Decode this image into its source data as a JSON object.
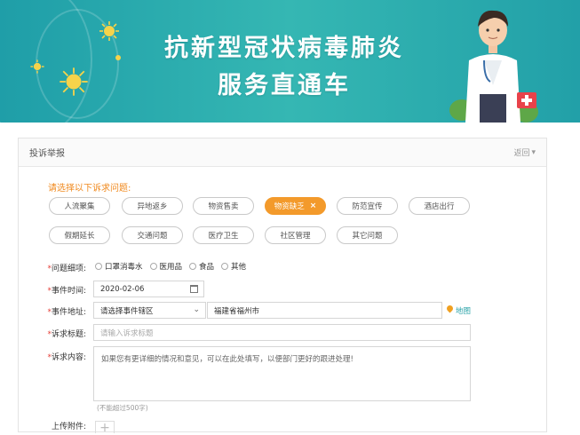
{
  "banner": {
    "title_line1": "抗新型冠状病毒肺炎",
    "title_line2": "服务直通车"
  },
  "panel": {
    "title": "投诉举报",
    "back_label": "返回",
    "back_icon": "chevron-down-icon"
  },
  "prompt": "请选择以下诉求问题:",
  "tags": [
    {
      "label": "人流聚集",
      "active": false
    },
    {
      "label": "异地返乡",
      "active": false
    },
    {
      "label": "物资售卖",
      "active": false
    },
    {
      "label": "物资缺乏",
      "active": true
    },
    {
      "label": "防范宣传",
      "active": false
    },
    {
      "label": "酒店出行",
      "active": false
    },
    {
      "label": "假期延长",
      "active": false
    },
    {
      "label": "交通问题",
      "active": false
    },
    {
      "label": "医疗卫生",
      "active": false
    },
    {
      "label": "社区管理",
      "active": false
    },
    {
      "label": "其它问题",
      "active": false
    }
  ],
  "form": {
    "detail_label": "问题细项:",
    "detail_options": [
      "口罩消毒水",
      "医用品",
      "食品",
      "其他"
    ],
    "time_label": "事件时间:",
    "time_value": "2020-02-06",
    "location_label": "事件地址:",
    "district_placeholder": "请选择事件辖区",
    "address_value": "福建省福州市",
    "map_label": "地图",
    "subject_label": "诉求标题:",
    "subject_placeholder": "请输入诉求标题",
    "content_label": "诉求内容:",
    "content_placeholder": "如果您有更详细的情况和意见，可以在此处填写，以便部门更好的跟进处理!",
    "content_limit": "(不能超过500字)",
    "upload_label": "上传附件:",
    "required_mark": "*"
  },
  "colors": {
    "banner": "#2aa9ad",
    "accent": "#f39a2b",
    "prompt": "#f0891d",
    "required": "#e5413a",
    "link": "#2aa3a8"
  }
}
